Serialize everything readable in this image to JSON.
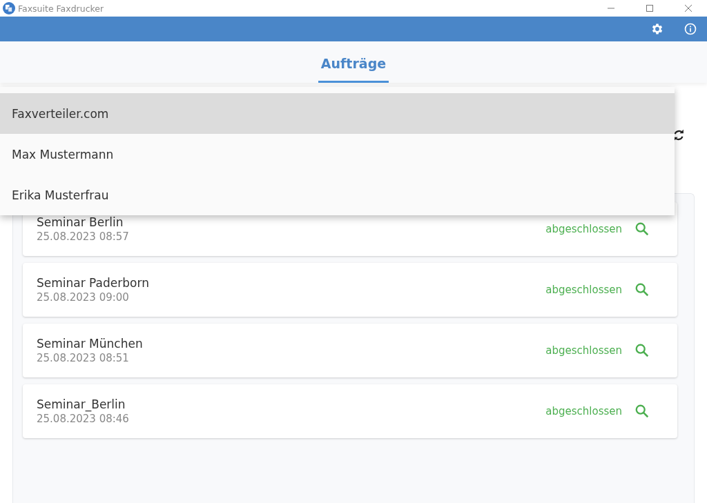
{
  "window": {
    "title": "Faxsuite Faxdrucker"
  },
  "tabs": [
    {
      "label": "Aufträge",
      "selected": true
    }
  ],
  "dropdown": {
    "options": [
      {
        "label": "Faxverteiler.com",
        "selected": true
      },
      {
        "label": "Max Mustermann",
        "selected": false
      },
      {
        "label": "Erika Musterfrau",
        "selected": false
      }
    ]
  },
  "jobs": [
    {
      "title": "Seminar Berlin",
      "date": "25.08.2023 08:57",
      "status": "abgeschlossen"
    },
    {
      "title": "Seminar Paderborn",
      "date": "25.08.2023 09:00",
      "status": "abgeschlossen"
    },
    {
      "title": "Seminar München",
      "date": "25.08.2023 08:51",
      "status": "abgeschlossen"
    },
    {
      "title": "Seminar_Berlin",
      "date": "25.08.2023 08:46",
      "status": "abgeschlossen"
    }
  ]
}
